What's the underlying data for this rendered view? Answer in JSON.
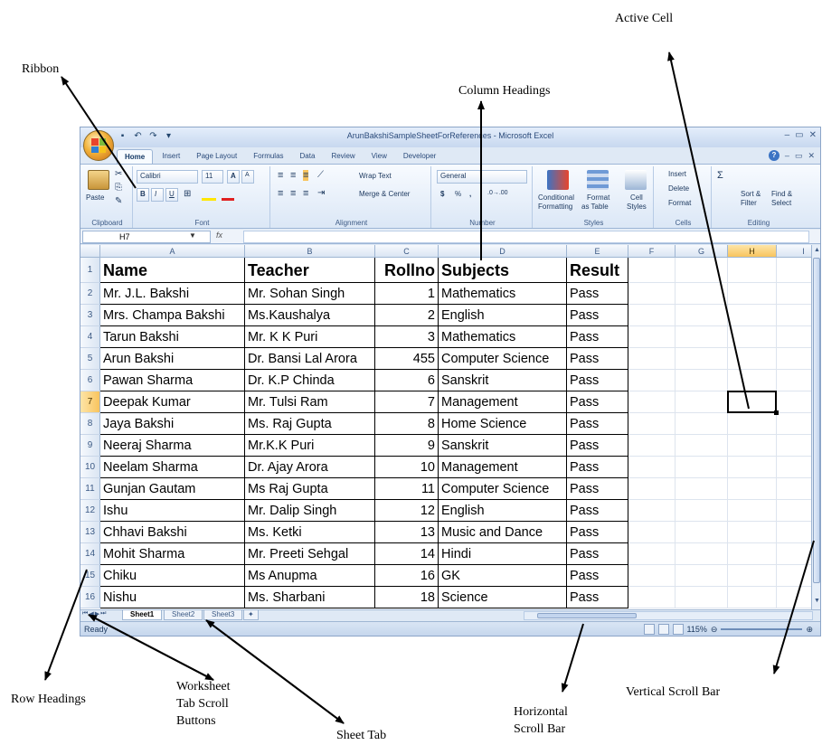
{
  "annotations": {
    "active_cell": "Active Cell",
    "ribbon": "Ribbon",
    "column_headings": "Column Headings",
    "row_headings": "Row Headings",
    "tab_scroll_line1": "Worksheet",
    "tab_scroll_line2": "Tab Scroll",
    "tab_scroll_line3": "Buttons",
    "sheet_tab": "Sheet Tab",
    "hscroll_line1": "Horizontal",
    "hscroll_line2": "Scroll Bar",
    "vscroll": "Vertical Scroll Bar"
  },
  "window": {
    "title": "ArunBakshiSampleSheetForReferences - Microsoft Excel",
    "controls": [
      "–",
      "▭",
      "✕"
    ]
  },
  "ribbon_tabs": [
    "Home",
    "Insert",
    "Page Layout",
    "Formulas",
    "Data",
    "Review",
    "View",
    "Developer"
  ],
  "ribbon": {
    "clipboard": {
      "label": "Clipboard",
      "paste": "Paste"
    },
    "font": {
      "label": "Font",
      "name": "Calibri",
      "size": "11",
      "grow": "A",
      "shrink": "A",
      "bold": "B",
      "italic": "I",
      "underline": "U"
    },
    "alignment": {
      "label": "Alignment",
      "wrap": "Wrap Text",
      "merge": "Merge & Center"
    },
    "number": {
      "label": "Number",
      "format": "General",
      "currency": "$",
      "percent": "%",
      "comma": ","
    },
    "styles": {
      "label": "Styles",
      "conditional": "Conditional",
      "formatting": "Formatting",
      "format_as": "Format",
      "as_table": "as Table",
      "cell": "Cell",
      "cell_styles": "Styles"
    },
    "cells": {
      "label": "Cells",
      "insert": "Insert",
      "delete": "Delete",
      "format": "Format"
    },
    "editing": {
      "label": "Editing",
      "sigma": "Σ",
      "sort": "Sort &",
      "filter": "Filter",
      "find": "Find &",
      "select": "Select"
    }
  },
  "formula_bar": {
    "name_box": "H7",
    "fx": "fx"
  },
  "columns": [
    "A",
    "B",
    "C",
    "D",
    "E",
    "F",
    "G",
    "H",
    "I"
  ],
  "rows": [
    {
      "num": "1",
      "name": "Name",
      "teacher": "Teacher",
      "rollno": "Rollno",
      "subject": "Subjects",
      "result": "Result"
    },
    {
      "num": "2",
      "name": "Mr. J.L. Bakshi",
      "teacher": "Mr. Sohan Singh",
      "rollno": "1",
      "subject": "Mathematics",
      "result": "Pass"
    },
    {
      "num": "3",
      "name": "Mrs. Champa Bakshi",
      "teacher": "Ms.Kaushalya",
      "rollno": "2",
      "subject": "English",
      "result": "Pass"
    },
    {
      "num": "4",
      "name": "Tarun Bakshi",
      "teacher": "Mr. K K Puri",
      "rollno": "3",
      "subject": "Mathematics",
      "result": "Pass"
    },
    {
      "num": "5",
      "name": "Arun Bakshi",
      "teacher": "Dr. Bansi Lal Arora",
      "rollno": "455",
      "subject": "Computer Science",
      "result": "Pass"
    },
    {
      "num": "6",
      "name": "Pawan Sharma",
      "teacher": "Dr. K.P Chinda",
      "rollno": "6",
      "subject": "Sanskrit",
      "result": "Pass"
    },
    {
      "num": "7",
      "name": "Deepak Kumar",
      "teacher": "Mr. Tulsi Ram",
      "rollno": "7",
      "subject": "Management",
      "result": "Pass"
    },
    {
      "num": "8",
      "name": "Jaya Bakshi",
      "teacher": "Ms. Raj Gupta",
      "rollno": "8",
      "subject": "Home Science",
      "result": "Pass"
    },
    {
      "num": "9",
      "name": "Neeraj Sharma",
      "teacher": "Mr.K.K Puri",
      "rollno": "9",
      "subject": "Sanskrit",
      "result": "Pass"
    },
    {
      "num": "10",
      "name": "Neelam Sharma",
      "teacher": "Dr. Ajay Arora",
      "rollno": "10",
      "subject": "Management",
      "result": "Pass"
    },
    {
      "num": "11",
      "name": "Gunjan Gautam",
      "teacher": "Ms Raj Gupta",
      "rollno": "11",
      "subject": "Computer Science",
      "result": "Pass"
    },
    {
      "num": "12",
      "name": "Ishu",
      "teacher": "Mr. Dalip Singh",
      "rollno": "12",
      "subject": "English",
      "result": "Pass"
    },
    {
      "num": "13",
      "name": "Chhavi Bakshi",
      "teacher": "Ms. Ketki",
      "rollno": "13",
      "subject": "Music and Dance",
      "result": "Pass"
    },
    {
      "num": "14",
      "name": "Mohit Sharma",
      "teacher": "Mr. Preeti Sehgal",
      "rollno": "14",
      "subject": "Hindi",
      "result": "Pass"
    },
    {
      "num": "15",
      "name": "Chiku",
      "teacher": "Ms Anupma",
      "rollno": "16",
      "subject": "GK",
      "result": "Pass"
    },
    {
      "num": "16",
      "name": "Nishu",
      "teacher": "Ms. Sharbani",
      "rollno": "18",
      "subject": "Science",
      "result": "Pass"
    }
  ],
  "sheet_tabs": [
    "Sheet1",
    "Sheet2",
    "Sheet3"
  ],
  "status": {
    "ready": "Ready",
    "zoom": "115%"
  },
  "colors": {
    "accent": "#f8c45e",
    "ribbon": "#dbe7f6",
    "frame": "#8ca5c8"
  }
}
